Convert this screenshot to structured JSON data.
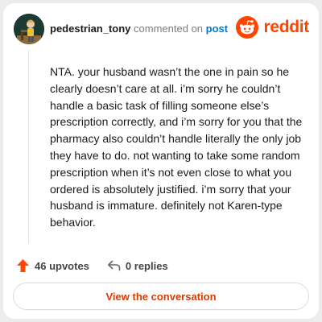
{
  "comment": {
    "username": "pedestrian_tony",
    "commented_text": " commented on ",
    "post_link": "post",
    "body": "NTA. your husband wasn’t the one in pain so he clearly doesn’t care at all. i’m sorry he couldn’t handle a basic task of filling someone else’s prescription correctly, and i’m sorry for you that the pharmacy also couldn’t handle literally the only job they have to do. not wanting to take some random prescription when it’s not even close to what you ordered is absolutely justified. i’m sorry that your husband is immature. definitely not Karen-type behavior."
  },
  "brand": {
    "wordmark": "reddit",
    "logo_icon": "reddit-snoo-icon",
    "color": "#ff4500"
  },
  "actions": {
    "upvotes": "46 upvotes",
    "replies": "0 replies",
    "upvote_icon": "upvote-arrow-icon",
    "reply_icon": "reply-arrow-icon",
    "upvote_color": "#ff4500"
  },
  "cta": {
    "label": "View the conversation"
  }
}
